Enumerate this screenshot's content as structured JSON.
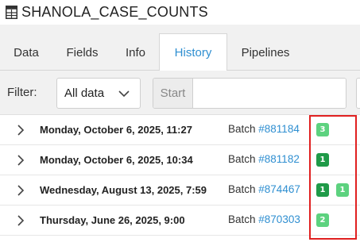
{
  "window": {
    "title": "SHANOLA_CASE_COUNTS",
    "icon": "table-icon"
  },
  "tabs": [
    {
      "label": "Data",
      "active": false
    },
    {
      "label": "Fields",
      "active": false
    },
    {
      "label": "Info",
      "active": false
    },
    {
      "label": "History",
      "active": true
    },
    {
      "label": "Pipelines",
      "active": false
    }
  ],
  "filter": {
    "label": "Filter:",
    "selected": "All data",
    "start_addon": "Start",
    "start_value": ""
  },
  "history": [
    {
      "date": "Monday, October 6, 2025, 11:27",
      "batch_prefix": "Batch ",
      "batch_id": "#881184",
      "badges": [
        {
          "count": "3",
          "color": "#5dd27f"
        }
      ]
    },
    {
      "date": "Monday, October 6, 2025, 10:34",
      "batch_prefix": "Batch ",
      "batch_id": "#881182",
      "badges": [
        {
          "count": "1",
          "color": "#1f9a48"
        }
      ]
    },
    {
      "date": "Wednesday, August 13, 2025, 7:59",
      "batch_prefix": "Batch ",
      "batch_id": "#874467",
      "badges": [
        {
          "count": "1",
          "color": "#1f9a48"
        },
        {
          "count": "1",
          "color": "#5dd27f"
        }
      ]
    },
    {
      "date": "Thursday, June 26, 2025, 9:00",
      "batch_prefix": "Batch ",
      "batch_id": "#870303",
      "badges": [
        {
          "count": "2",
          "color": "#5dd27f"
        }
      ]
    }
  ],
  "colors": {
    "accent": "#2f8fd1",
    "highlight": "#e02020"
  }
}
